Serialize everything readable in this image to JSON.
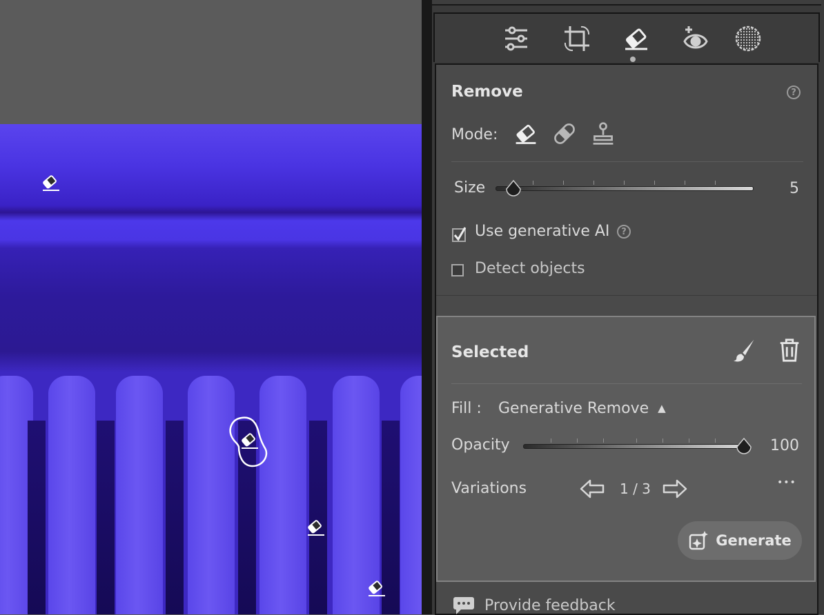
{
  "panel": {
    "remove_title": "Remove",
    "mode_label": "Mode:",
    "size_label": "Size",
    "size_value": "5",
    "size_level_percent": 7,
    "gen_ai_label": "Use generative AI",
    "gen_ai_checked": true,
    "detect_label": "Detect objects",
    "detect_checked": false
  },
  "selected": {
    "title": "Selected",
    "fill_label": "Fill :",
    "fill_value": "Generative Remove",
    "opacity_label": "Opacity",
    "opacity_value": "100",
    "opacity_level_percent": 100,
    "variations_label": "Variations",
    "variations_counter": "1 / 3",
    "more_glyph": "•••",
    "generate_label": "Generate"
  },
  "feedback_label": "Provide feedback",
  "toolbar_icons": [
    "edit-sliders-icon",
    "crop-rotate-icon",
    "eraser-icon",
    "red-eye-icon",
    "masking-icon"
  ],
  "colors": {
    "accent_photo": "#4a35e4",
    "panel_bg": "#4a4a4a",
    "selected_bg": "#5c5c5c"
  }
}
